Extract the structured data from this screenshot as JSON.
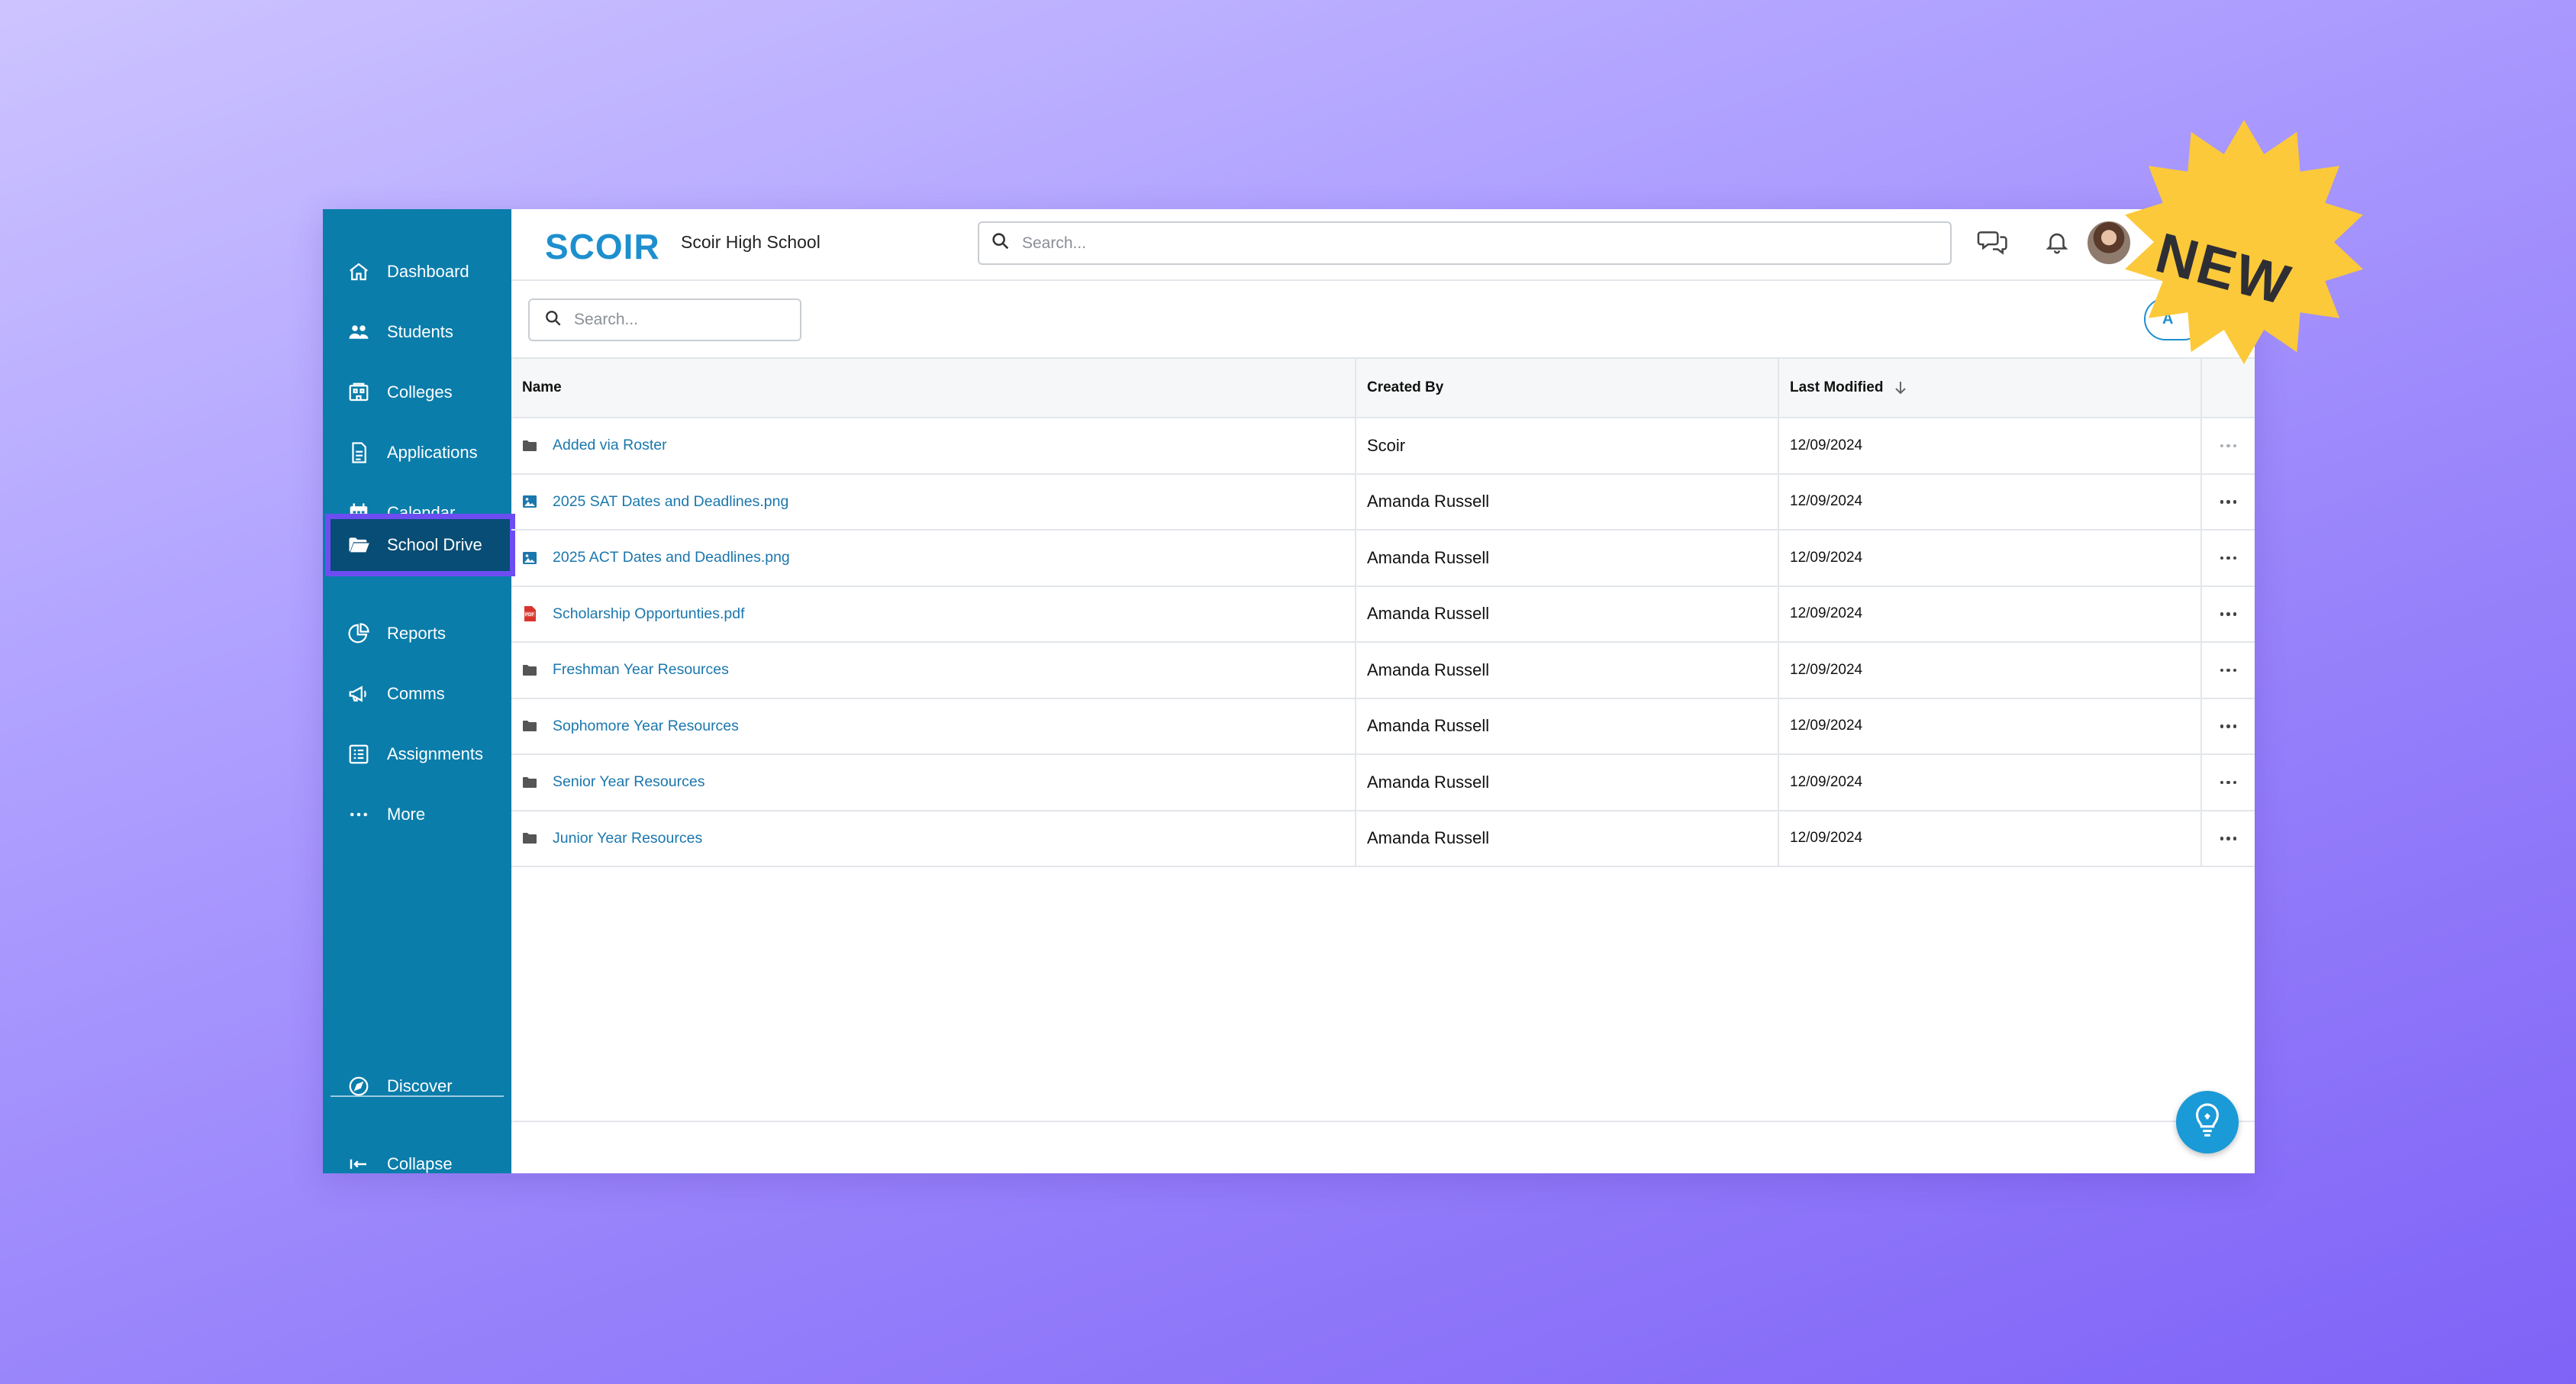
{
  "sidebar": {
    "items": [
      {
        "label": "Dashboard",
        "icon": "home-icon"
      },
      {
        "label": "Students",
        "icon": "users-icon"
      },
      {
        "label": "Colleges",
        "icon": "college-icon"
      },
      {
        "label": "Applications",
        "icon": "document-icon"
      },
      {
        "label": "Calendar",
        "icon": "calendar-icon"
      },
      {
        "label": "School Drive",
        "icon": "folder-open-icon",
        "active": true
      },
      {
        "label": "Reports",
        "icon": "pie-chart-icon"
      },
      {
        "label": "Comms",
        "icon": "megaphone-icon"
      },
      {
        "label": "Assignments",
        "icon": "checklist-icon"
      },
      {
        "label": "More",
        "icon": "more-icon"
      }
    ],
    "discover": "Discover",
    "collapse": "Collapse"
  },
  "header": {
    "logo": "SCOIR",
    "school": "Scoir High School",
    "search_placeholder": "Search..."
  },
  "list": {
    "search_placeholder": "Search...",
    "partial_button": "A"
  },
  "table": {
    "columns": {
      "name": "Name",
      "created_by": "Created By",
      "last_modified": "Last Modified"
    },
    "sort": "descending",
    "rows": [
      {
        "name": "Added via Roster",
        "type": "folder",
        "created_by": "Scoir",
        "modified": "12/09/2024"
      },
      {
        "name": "2025 SAT Dates and Deadlines.png",
        "type": "image",
        "created_by": "Amanda Russell",
        "modified": "12/09/2024"
      },
      {
        "name": "2025 ACT Dates and Deadlines.png",
        "type": "image",
        "created_by": "Amanda Russell",
        "modified": "12/09/2024"
      },
      {
        "name": "Scholarship Opportunties.pdf",
        "type": "pdf",
        "created_by": "Amanda Russell",
        "modified": "12/09/2024"
      },
      {
        "name": "Freshman Year Resources",
        "type": "folder",
        "created_by": "Amanda Russell",
        "modified": "12/09/2024"
      },
      {
        "name": "Sophomore Year Resources",
        "type": "folder",
        "created_by": "Amanda Russell",
        "modified": "12/09/2024"
      },
      {
        "name": "Senior Year Resources",
        "type": "folder",
        "created_by": "Amanda Russell",
        "modified": "12/09/2024"
      },
      {
        "name": "Junior Year Resources",
        "type": "folder",
        "created_by": "Amanda Russell",
        "modified": "12/09/2024"
      }
    ]
  },
  "badge": {
    "text": "NEW",
    "color": "#fcc93a"
  },
  "colors": {
    "sidebar": "#0a7dab",
    "active_nav": "#084d75",
    "highlight": "#6d4df2",
    "link": "#1b77ad"
  }
}
